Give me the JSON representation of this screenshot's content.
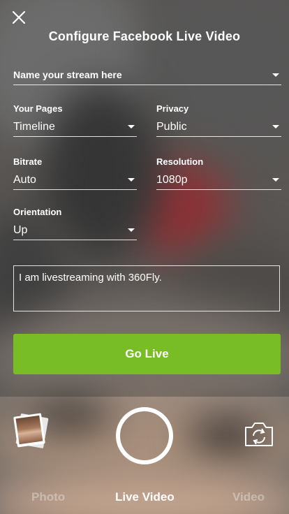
{
  "header": {
    "title": "Configure Facebook Live Video",
    "close_icon": "close-icon"
  },
  "form": {
    "stream_name": {
      "placeholder": "Name your stream here"
    },
    "pages": {
      "label": "Your Pages",
      "value": "Timeline"
    },
    "privacy": {
      "label": "Privacy",
      "value": "Public"
    },
    "bitrate": {
      "label": "Bitrate",
      "value": "Auto"
    },
    "resolution": {
      "label": "Resolution",
      "value": "1080p"
    },
    "orientation": {
      "label": "Orientation",
      "value": "Up"
    },
    "message": {
      "value": "I am livestreaming with 360Fly."
    }
  },
  "actions": {
    "go_live": "Go Live"
  },
  "camera": {
    "gallery_icon": "gallery-thumbnail-icon",
    "shutter_icon": "shutter-button",
    "flip_icon": "flip-camera-icon"
  },
  "tabs": [
    {
      "label": "Photo",
      "active": false
    },
    {
      "label": "Live Video",
      "active": true
    },
    {
      "label": "Video",
      "active": false
    }
  ],
  "colors": {
    "accent": "#78bd25",
    "text": "#ffffff"
  }
}
